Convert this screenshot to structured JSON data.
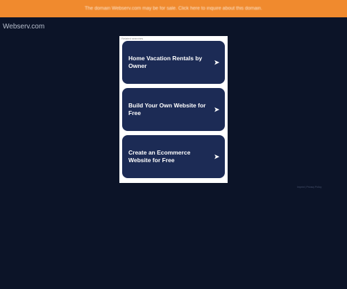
{
  "banner": {
    "text": "The domain Webserv.com may be for sale. Click here to inquire about this domain."
  },
  "site": {
    "name": "Webserv.com"
  },
  "panel": {
    "label": "Related searches",
    "items": [
      {
        "title": "Home Vacation Rentals by Owner"
      },
      {
        "title": "Build Your Own Website for Free"
      },
      {
        "title": "Create an Ecommerce Website for Free"
      }
    ]
  },
  "footer": {
    "links": "Imprint   |   Privacy Policy"
  },
  "colors": {
    "banner": "#f08a2e",
    "background": "#0c1428",
    "card": "#1c2b55"
  }
}
